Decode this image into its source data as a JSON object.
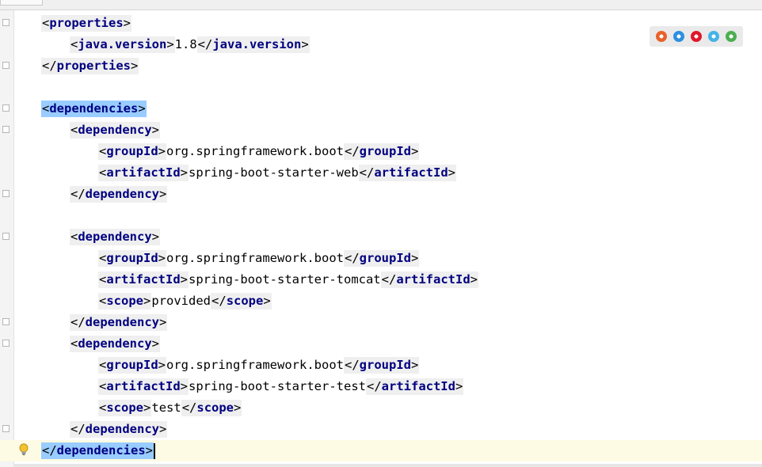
{
  "editor": {
    "lines": [
      {
        "indent": 1,
        "parts": [
          {
            "k": "tag",
            "open": "<",
            "name": "properties",
            "close": ">"
          }
        ]
      },
      {
        "indent": 2,
        "parts": [
          {
            "k": "tag",
            "open": "<",
            "name": "java.version",
            "close": ">"
          },
          {
            "k": "txt",
            "v": "1.8"
          },
          {
            "k": "tag",
            "open": "</",
            "name": "java.version",
            "close": ">"
          }
        ]
      },
      {
        "indent": 1,
        "parts": [
          {
            "k": "tag",
            "open": "</",
            "name": "properties",
            "close": ">"
          }
        ]
      },
      {
        "indent": 0,
        "parts": []
      },
      {
        "indent": 1,
        "parts": [
          {
            "k": "tag",
            "open": "<",
            "name": "dependencies",
            "close": ">",
            "selected": true
          }
        ]
      },
      {
        "indent": 2,
        "parts": [
          {
            "k": "tag",
            "open": "<",
            "name": "dependency",
            "close": ">"
          }
        ]
      },
      {
        "indent": 3,
        "parts": [
          {
            "k": "tag",
            "open": "<",
            "name": "groupId",
            "close": ">"
          },
          {
            "k": "txt",
            "v": "org.springframework.boot"
          },
          {
            "k": "tag",
            "open": "</",
            "name": "groupId",
            "close": ">"
          }
        ]
      },
      {
        "indent": 3,
        "parts": [
          {
            "k": "tag",
            "open": "<",
            "name": "artifactId",
            "close": ">"
          },
          {
            "k": "txt",
            "v": "spring-boot-starter-web"
          },
          {
            "k": "tag",
            "open": "</",
            "name": "artifactId",
            "close": ">"
          }
        ]
      },
      {
        "indent": 2,
        "parts": [
          {
            "k": "tag",
            "open": "</",
            "name": "dependency",
            "close": ">"
          }
        ]
      },
      {
        "indent": 0,
        "parts": []
      },
      {
        "indent": 2,
        "parts": [
          {
            "k": "tag",
            "open": "<",
            "name": "dependency",
            "close": ">"
          }
        ]
      },
      {
        "indent": 3,
        "parts": [
          {
            "k": "tag",
            "open": "<",
            "name": "groupId",
            "close": ">"
          },
          {
            "k": "txt",
            "v": "org.springframework.boot"
          },
          {
            "k": "tag",
            "open": "</",
            "name": "groupId",
            "close": ">"
          }
        ]
      },
      {
        "indent": 3,
        "parts": [
          {
            "k": "tag",
            "open": "<",
            "name": "artifactId",
            "close": ">"
          },
          {
            "k": "txt",
            "v": "spring-boot-starter-tomcat"
          },
          {
            "k": "tag",
            "open": "</",
            "name": "artifactId",
            "close": ">"
          }
        ]
      },
      {
        "indent": 3,
        "parts": [
          {
            "k": "tag",
            "open": "<",
            "name": "scope",
            "close": ">"
          },
          {
            "k": "txt",
            "v": "provided"
          },
          {
            "k": "tag",
            "open": "</",
            "name": "scope",
            "close": ">"
          }
        ]
      },
      {
        "indent": 2,
        "parts": [
          {
            "k": "tag",
            "open": "</",
            "name": "dependency",
            "close": ">"
          }
        ]
      },
      {
        "indent": 2,
        "parts": [
          {
            "k": "tag",
            "open": "<",
            "name": "dependency",
            "close": ">"
          }
        ]
      },
      {
        "indent": 3,
        "parts": [
          {
            "k": "tag",
            "open": "<",
            "name": "groupId",
            "close": ">"
          },
          {
            "k": "txt",
            "v": "org.springframework.boot"
          },
          {
            "k": "tag",
            "open": "</",
            "name": "groupId",
            "close": ">"
          }
        ]
      },
      {
        "indent": 3,
        "parts": [
          {
            "k": "tag",
            "open": "<",
            "name": "artifactId",
            "close": ">"
          },
          {
            "k": "txt",
            "v": "spring-boot-starter-test"
          },
          {
            "k": "tag",
            "open": "</",
            "name": "artifactId",
            "close": ">"
          }
        ]
      },
      {
        "indent": 3,
        "parts": [
          {
            "k": "tag",
            "open": "<",
            "name": "scope",
            "close": ">"
          },
          {
            "k": "txt",
            "v": "test"
          },
          {
            "k": "tag",
            "open": "</",
            "name": "scope",
            "close": ">"
          }
        ]
      },
      {
        "indent": 2,
        "parts": [
          {
            "k": "tag",
            "open": "</",
            "name": "dependency",
            "close": ">"
          }
        ]
      },
      {
        "indent": 1,
        "parts": [
          {
            "k": "tag",
            "open": "</",
            "name": "dependencies",
            "close": ">",
            "selected": true
          }
        ],
        "current": true,
        "caret": true
      }
    ]
  },
  "browser_bar": {
    "icons": [
      {
        "name": "firefox-icon",
        "color": "#e8622a"
      },
      {
        "name": "safari-icon",
        "color": "#2f8fe0"
      },
      {
        "name": "opera-icon",
        "color": "#e0182b"
      },
      {
        "name": "internet-explorer-icon",
        "color": "#44b4e6"
      },
      {
        "name": "chrome-icon",
        "color": "#4caf50"
      }
    ]
  },
  "colors": {
    "tag_name": "#000080",
    "tag_bg": "#efefef",
    "selection": "#99ccff",
    "current_line": "#fdfbe3"
  }
}
